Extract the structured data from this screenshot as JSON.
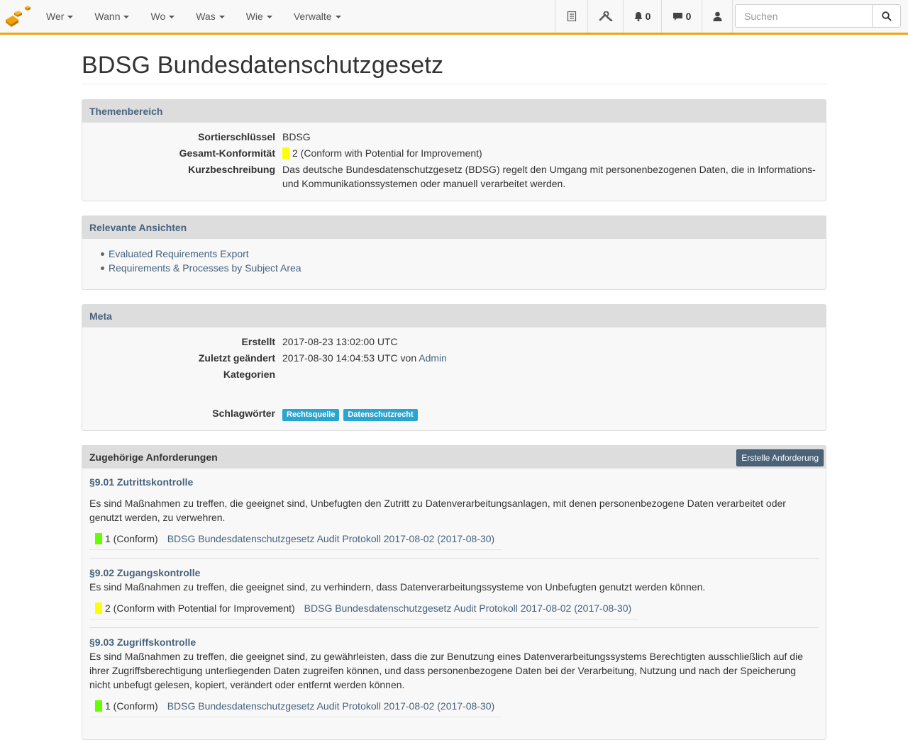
{
  "nav": {
    "menu": [
      "Wer",
      "Wann",
      "Wo",
      "Was",
      "Wie",
      "Verwalte"
    ],
    "notifications_count": "0",
    "messages_count": "0",
    "search_placeholder": "Suchen",
    "icons": [
      "list-icon",
      "wrench-icon",
      "bell-icon",
      "comment-icon",
      "user-icon",
      "search-icon"
    ]
  },
  "colors": {
    "accent": "#f0a30a",
    "link": "#46627e",
    "conform_green": "#66ff00",
    "conform_yellow": "#ffff00",
    "tag_blue": "#2aa4d0"
  },
  "page": {
    "title": "BDSG Bundesdatenschutzgesetz"
  },
  "themenbereich": {
    "heading": "Themenbereich",
    "sort_label": "Sortierschlüssel",
    "sort_value": "BDSG",
    "conformity_label": "Gesamt-Konformität",
    "conformity_value": "2 (Conform with Potential for Improvement)",
    "desc_label": "Kurzbeschreibung",
    "desc_value": "Das deutsche Bundesdatenschutzgesetz (BDSG) regelt den Umgang mit personenbezogenen Daten, die in Informations- und Kommunikationssystemen oder manuell verarbeitet werden."
  },
  "views": {
    "heading": "Relevante Ansichten",
    "items": [
      "Evaluated Requirements Export",
      "Requirements & Processes by Subject Area"
    ]
  },
  "meta": {
    "heading": "Meta",
    "created_label": "Erstellt",
    "created_value": "2017-08-23 13:02:00 UTC",
    "modified_label": "Zuletzt geändert",
    "modified_value": "2017-08-30 14:04:53 UTC von",
    "modified_by": "Admin",
    "categories_label": "Kategorien",
    "tags_label": "Schlagwörter",
    "tags": [
      "Rechtsquelle",
      "Datenschutzrecht"
    ]
  },
  "requirements": {
    "heading": "Zugehörige Anforderungen",
    "create_button": "Erstelle Anforderung",
    "items": [
      {
        "title": "§9.01 Zutrittskontrolle",
        "description": "Es sind Maßnahmen zu treffen, die geeignet sind, Unbefugten den Zutritt zu Datenverarbeitungsanlagen, mit denen personenbezogene Daten verarbeitet oder genutzt werden, zu verwehren.",
        "evaluation": "1 (Conform)",
        "evaluation_color": "green",
        "audit": "BDSG Bundesdatenschutzgesetz Audit Protokoll 2017-08-02 (2017-08-30)"
      },
      {
        "title": "§9.02 Zugangskontrolle",
        "description": "Es sind Maßnahmen zu treffen, die geeignet sind, zu verhindern, dass Datenverarbeitungssysteme von Unbefugten genutzt werden können.",
        "evaluation": "2 (Conform with Potential for Improvement)",
        "evaluation_color": "yellow",
        "audit": "BDSG Bundesdatenschutzgesetz Audit Protokoll 2017-08-02 (2017-08-30)"
      },
      {
        "title": "§9.03 Zugriffskontrolle",
        "description": "Es sind Maßnahmen zu treffen, die geeignet sind, zu gewährleisten, dass die zur Benutzung eines Datenverarbeitungssystems Berechtigten ausschließlich auf die ihrer Zugriffsberechtigung unterliegenden Daten zugreifen können, und dass personenbezogene Daten bei der Verarbeitung, Nutzung und nach der Speicherung nicht unbefugt gelesen, kopiert, verändert oder entfernt werden können.",
        "evaluation": "1 (Conform)",
        "evaluation_color": "green",
        "audit": "BDSG Bundesdatenschutzgesetz Audit Protokoll 2017-08-02 (2017-08-30)"
      }
    ]
  }
}
